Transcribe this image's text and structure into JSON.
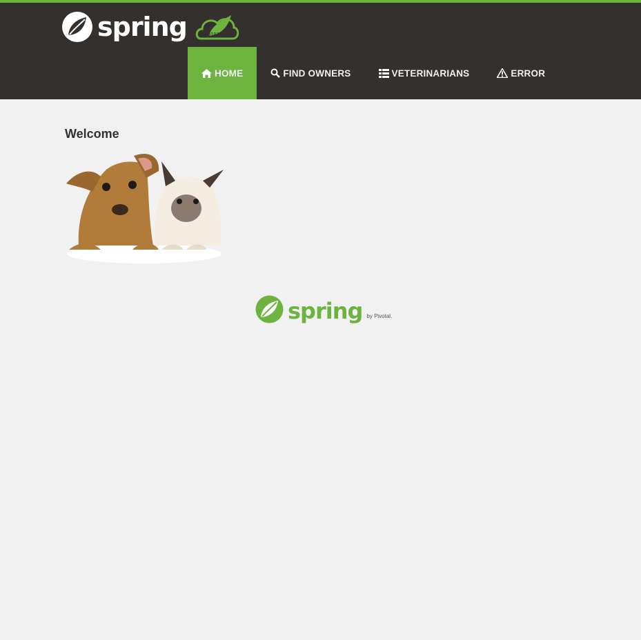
{
  "header": {
    "brand_text": "spring",
    "colors": {
      "bar": "#34302d",
      "accent": "#6db33f",
      "text": "#f1f1f1"
    }
  },
  "nav": {
    "items": [
      {
        "label": "HOME",
        "icon": "home-icon",
        "active": true
      },
      {
        "label": "FIND OWNERS",
        "icon": "search-icon",
        "active": false
      },
      {
        "label": "VETERINARIANS",
        "icon": "list-icon",
        "active": false
      },
      {
        "label": "ERROR",
        "icon": "warning-icon",
        "active": false
      }
    ]
  },
  "main": {
    "heading": "Welcome",
    "image": "pets-image"
  },
  "footer": {
    "brand_text": "spring",
    "by_text": "by Pivotal."
  }
}
